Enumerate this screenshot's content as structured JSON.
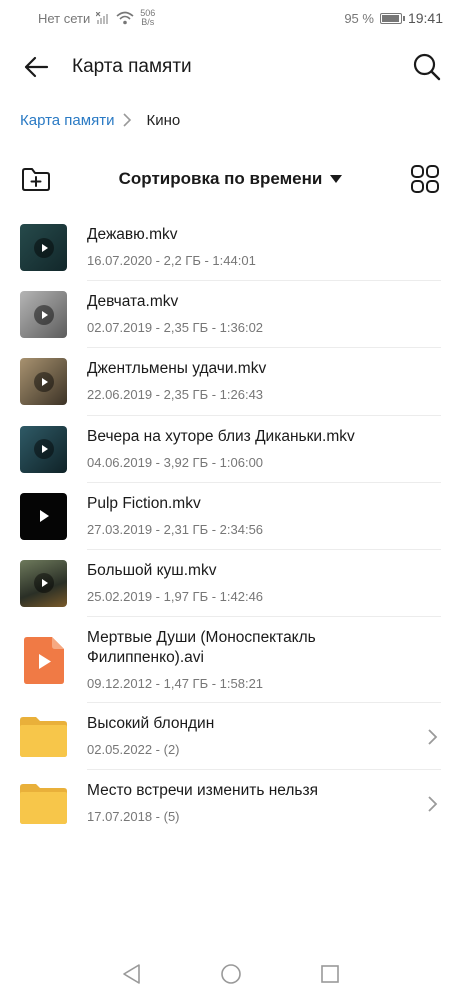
{
  "status_bar": {
    "network": "Нет сети",
    "speed_value": "506",
    "speed_unit": "B/s",
    "battery": "95 %",
    "time": "19:41"
  },
  "header": {
    "title": "Карта памяти",
    "back_icon": "arrow-left-icon",
    "search_icon": "search-icon"
  },
  "breadcrumb": {
    "root": "Карта памяти",
    "current": "Кино"
  },
  "toolbar": {
    "sort_label": "Сортировка по времени",
    "new_folder_icon": "new-folder-icon",
    "grid_icon": "grid-view-icon"
  },
  "colors": {
    "link": "#2a7ac4",
    "folder": "#f7c64a",
    "avi": "#f07a45"
  },
  "items": [
    {
      "name": "Дежавю.mkv",
      "meta": "16.07.2020 - 2,2 ГБ - 1:44:01",
      "kind": "video",
      "thumb": "#1f3a3c"
    },
    {
      "name": "Девчата.mkv",
      "meta": "02.07.2019 - 2,35 ГБ - 1:36:02",
      "kind": "video",
      "thumb": "#8a8a8a"
    },
    {
      "name": "Джентльмены удачи.mkv",
      "meta": "22.06.2019 - 2,35 ГБ - 1:26:43",
      "kind": "video",
      "thumb": "#6b5a44"
    },
    {
      "name": "Вечера на хуторе близ Диканьки.mkv",
      "meta": "04.06.2019 - 3,92 ГБ - 1:06:00",
      "kind": "video",
      "thumb": "#1d3a44"
    },
    {
      "name": "Pulp Fiction.mkv",
      "meta": "27.03.2019 - 2,31 ГБ - 2:34:56",
      "kind": "video",
      "thumb": "#050505"
    },
    {
      "name": "Большой куш.mkv",
      "meta": "25.02.2019 - 1,97 ГБ - 1:42:46",
      "kind": "video",
      "thumb": "#3f4a3c"
    },
    {
      "name": "Мертвые Души (Моноспектакль Филиппенко).avi",
      "meta": "09.12.2012 - 1,47 ГБ - 1:58:21",
      "kind": "avi"
    },
    {
      "name": "Высокий блондин",
      "meta": "02.05.2022 - (2)",
      "kind": "folder"
    },
    {
      "name": "Место встречи изменить нельзя",
      "meta": "17.07.2018 - (5)",
      "kind": "folder"
    }
  ],
  "nav_bar": {
    "back": "nav-back-icon",
    "home": "nav-home-icon",
    "recents": "nav-recents-icon"
  }
}
